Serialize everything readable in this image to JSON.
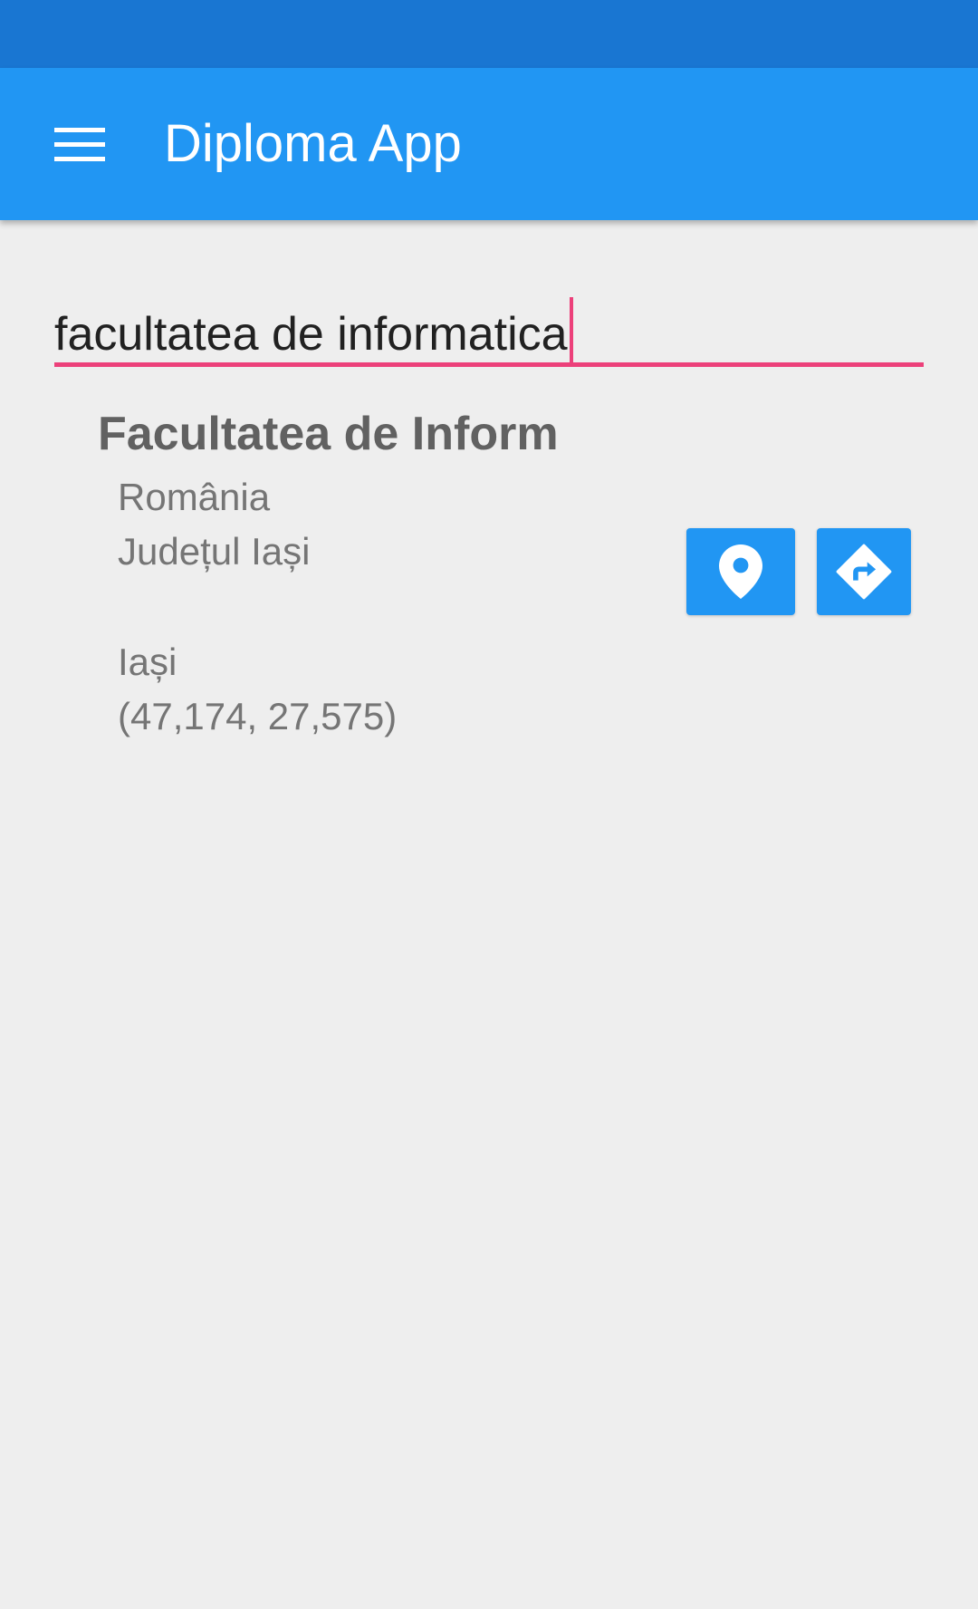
{
  "app_bar": {
    "title": "Diploma App",
    "menu_icon": "hamburger-menu-icon",
    "color": "#2196f3",
    "status_bar_color": "#1976d2"
  },
  "search": {
    "value": "facultatea de informatica",
    "accent_color": "#ec407a"
  },
  "result": {
    "name": "Facultatea de Inform",
    "country": "România",
    "county": "Județul Iași",
    "city": "Iași",
    "coordinates": "(47,174, 27,575)",
    "actions": [
      {
        "icon": "location-pin-icon"
      },
      {
        "icon": "directions-icon"
      }
    ]
  }
}
